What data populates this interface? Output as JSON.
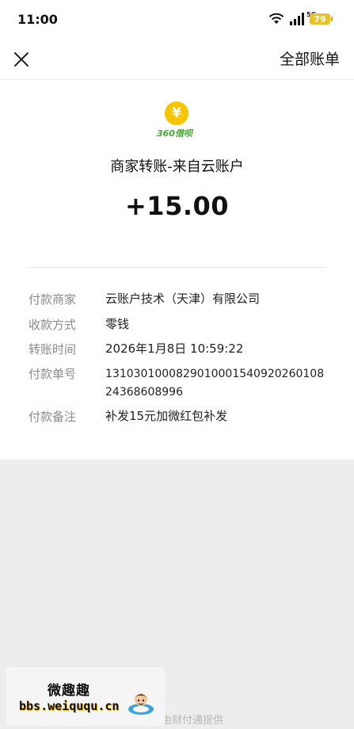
{
  "status_bar": {
    "time": "11:00",
    "network": "5G",
    "battery": "79"
  },
  "nav": {
    "close_icon": "close-icon",
    "right_link": "全部账单"
  },
  "transaction": {
    "logo_text": "360借呗",
    "logo_symbol": "¥",
    "title": "商家转账-来自云账户",
    "amount": "+15.00",
    "details": [
      {
        "label": "付款商家",
        "value": "云账户技术（天津）有限公司"
      },
      {
        "label": "收款方式",
        "value": "零钱"
      },
      {
        "label": "转账时间",
        "value": "2026年1月8日 10:59:22"
      },
      {
        "label": "付款单号",
        "value": "131030100082901000154092026010824368608996"
      },
      {
        "label": "付款备注",
        "value": "补发15元加微红包补发"
      }
    ]
  },
  "footer": {
    "text": "本服务由财付通提供"
  },
  "watermark": {
    "title": "微趣趣",
    "url": "bbs.weiququ.cn"
  },
  "colors": {
    "logo_yellow": "#f7c600",
    "logo_green": "#4aa63a",
    "page_bg": "#ededed"
  }
}
